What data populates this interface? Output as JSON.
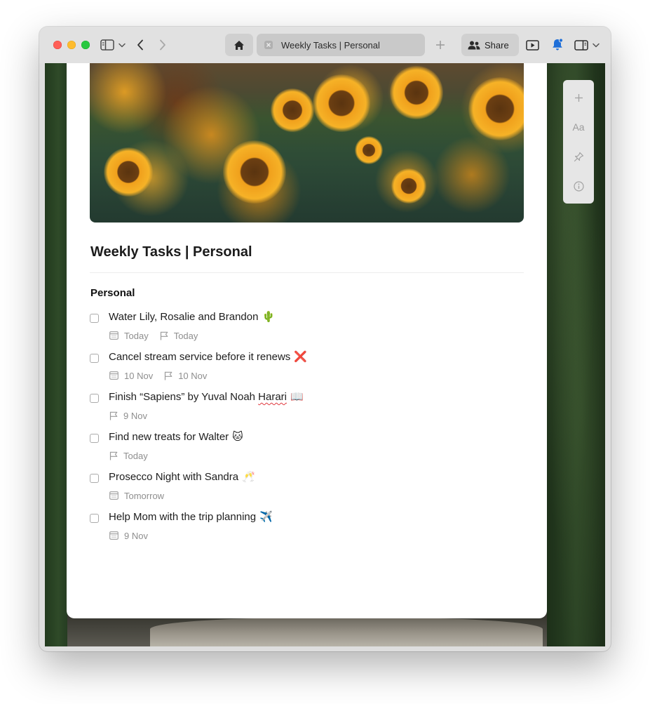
{
  "browser": {
    "tab_title": "Weekly Tasks | Personal",
    "share_label": "Share"
  },
  "page": {
    "title": "Weekly Tasks | Personal",
    "section": "Personal",
    "right_toolbar": {
      "add_icon": "plus-icon",
      "text_style_label": "Aa",
      "pin_icon": "pin-icon",
      "info_icon": "info-icon"
    },
    "tasks": [
      {
        "title": "Water Lily, Rosalie and Brandon",
        "emoji": "🌵",
        "meta": [
          {
            "icon": "calendar-icon",
            "label": "Today"
          },
          {
            "icon": "flag-icon",
            "label": "Today"
          }
        ]
      },
      {
        "title": "Cancel stream service before it renews",
        "emoji": "❌",
        "meta": [
          {
            "icon": "calendar-icon",
            "label": "10 Nov"
          },
          {
            "icon": "flag-icon",
            "label": "10 Nov"
          }
        ]
      },
      {
        "title_before": "Finish “Sapiens” by Yuval Noah ",
        "title_misspelled": "Harari",
        "emoji": "📖",
        "meta": [
          {
            "icon": "flag-icon",
            "label": "9 Nov"
          }
        ]
      },
      {
        "title": "Find new treats for Walter",
        "emoji": "🐱",
        "meta": [
          {
            "icon": "flag-icon",
            "label": "Today"
          }
        ]
      },
      {
        "title": "Prosecco Night with Sandra",
        "emoji": "🥂",
        "meta": [
          {
            "icon": "calendar-icon",
            "label": "Tomorrow"
          }
        ]
      },
      {
        "title": "Help Mom with the trip planning",
        "emoji": "✈️",
        "meta": [
          {
            "icon": "calendar-icon",
            "label": "9 Nov"
          }
        ]
      }
    ]
  }
}
